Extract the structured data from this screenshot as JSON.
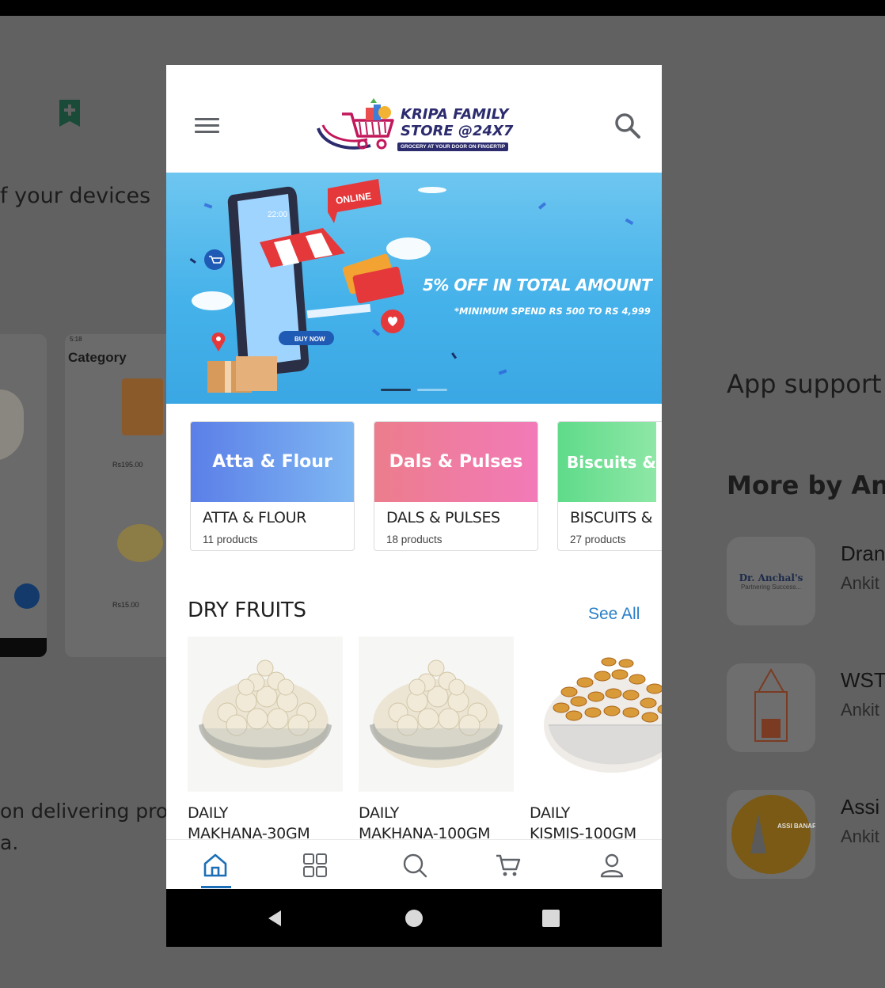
{
  "background": {
    "devices_text": "f your devices",
    "delivering_line1": "on delivering pro",
    "delivering_line2": "a.",
    "app_support": "App support",
    "more_by": "More by Ank",
    "screenshot_category": "Category",
    "screenshot_time": "5:18",
    "screenshot_price1": "Rs195.00",
    "screenshot_price2": "Rs15.00",
    "related_apps": [
      {
        "title": "Dran",
        "developer": "Ankit",
        "icon_text": "Dr. Anchal's",
        "icon_sub": "Partnering Success..."
      },
      {
        "title": "WST",
        "developer": "Ankit"
      },
      {
        "title": "Assi",
        "developer": "Ankit",
        "icon_text": "ASSI BANARAS"
      }
    ]
  },
  "header": {
    "logo_line1": "KRIPA FAMILY",
    "logo_line2": "STORE @24X7",
    "logo_tagline": "GROCERY AT YOUR DOOR ON FINGERTIP"
  },
  "banner": {
    "badge": "ONLINE",
    "headline": "5% OFF IN TOTAL AMOUNT",
    "subline": "*MINIMUM SPEND RS 500 TO RS 4,999",
    "phone_time": "22:00",
    "buy_now": "BUY NOW",
    "active_slide": 1,
    "slide_count": 2
  },
  "categories": [
    {
      "image_text": "Atta & Flour",
      "name": "ATTA & FLOUR",
      "count": "11 products",
      "color_from": "#5b7fe8",
      "color_to": "#7fb7f2"
    },
    {
      "image_text": "Dals & Pulses",
      "name": "DALS & PULSES",
      "count": "18 products",
      "color_from": "#ec7d8c",
      "color_to": "#f27ab8"
    },
    {
      "image_text": "Biscuits &",
      "name": "BISCUITS &",
      "count": "27 products",
      "color_from": "#5fdb8a",
      "color_to": "#8ee7a6"
    }
  ],
  "section": {
    "title": "DRY FRUITS",
    "see_all": "See All"
  },
  "products": [
    {
      "name_line1": "DAILY",
      "name_line2": "MAKHANA-30GM"
    },
    {
      "name_line1": "DAILY",
      "name_line2": "MAKHANA-100GM"
    },
    {
      "name_line1": "DAILY",
      "name_line2": "KISMIS-100GM"
    }
  ],
  "bottom_nav": [
    "home-icon",
    "grid-icon",
    "search-icon",
    "cart-icon",
    "profile-icon"
  ],
  "colors": {
    "accent": "#1c6fb7",
    "see_all": "#2b7fc8",
    "logo_navy": "#2b2b6e",
    "logo_pink": "#c2185b",
    "banner_blue": "#45b2ea"
  }
}
